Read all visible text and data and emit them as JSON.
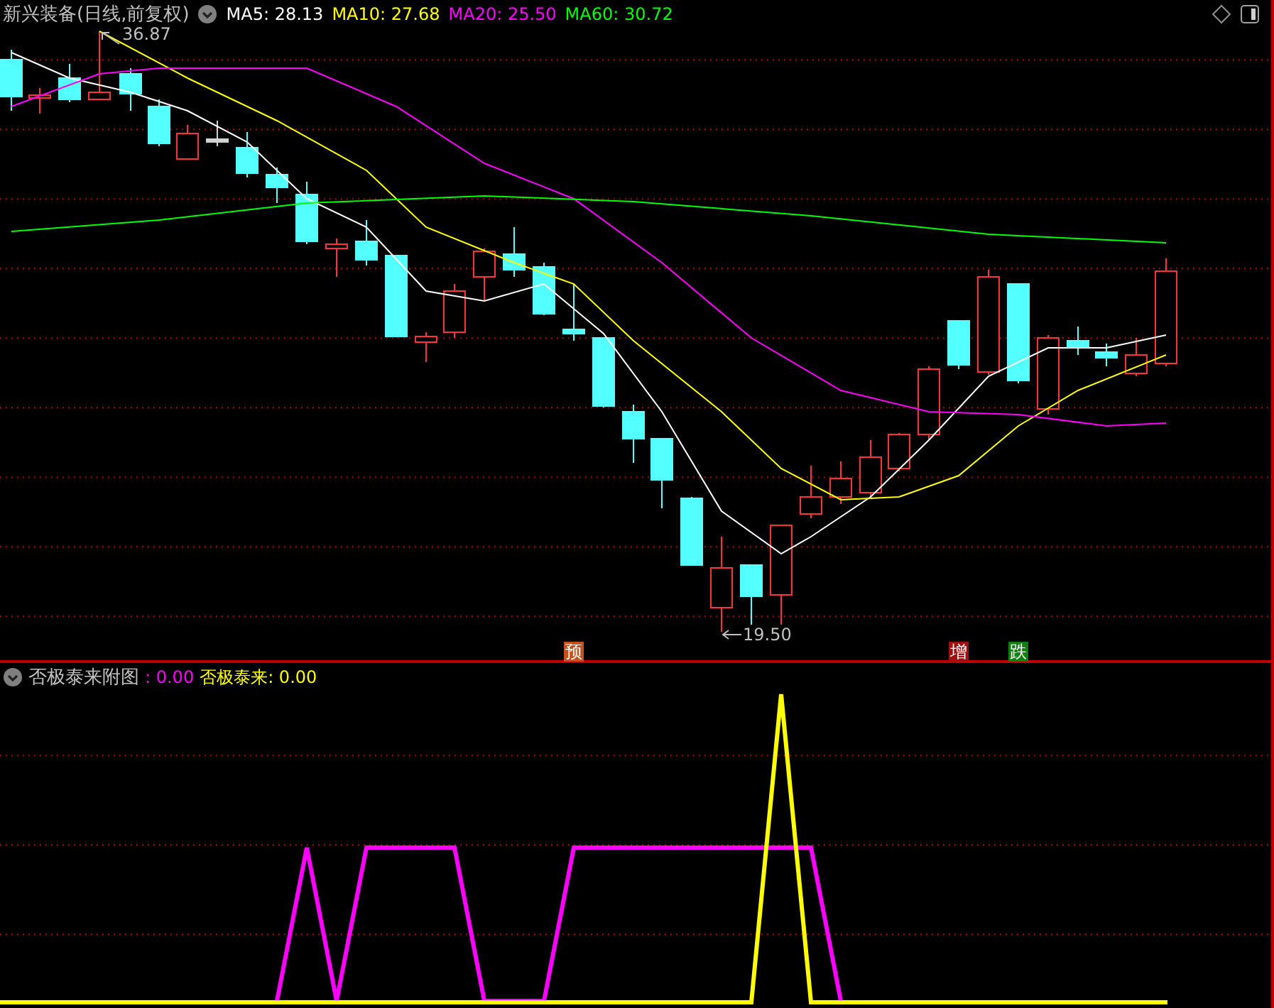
{
  "header": {
    "title": "新兴装备(日线,前复权)",
    "moving_averages": [
      {
        "label": "MA5: 28.13",
        "color": "#ffffff"
      },
      {
        "label": "MA10: 27.68",
        "color": "#ffff00"
      },
      {
        "label": "MA20: 25.50",
        "color": "#ff00ff"
      },
      {
        "label": "MA60: 30.72",
        "color": "#00ff00"
      }
    ]
  },
  "price_chart": {
    "high_label": "36.87",
    "low_label": "19.50",
    "signals": [
      {
        "text": "预",
        "color": "#c8501c"
      },
      {
        "text": "增",
        "color": "#a01010"
      },
      {
        "text": "跌",
        "color": "#108010"
      }
    ]
  },
  "indicator": {
    "title": "否极泰来附图",
    "values": [
      {
        "label": ": 0.00",
        "color": "#ff00ff"
      },
      {
        "label": "否极泰来: 0.00",
        "color": "#ffff00"
      }
    ]
  }
}
